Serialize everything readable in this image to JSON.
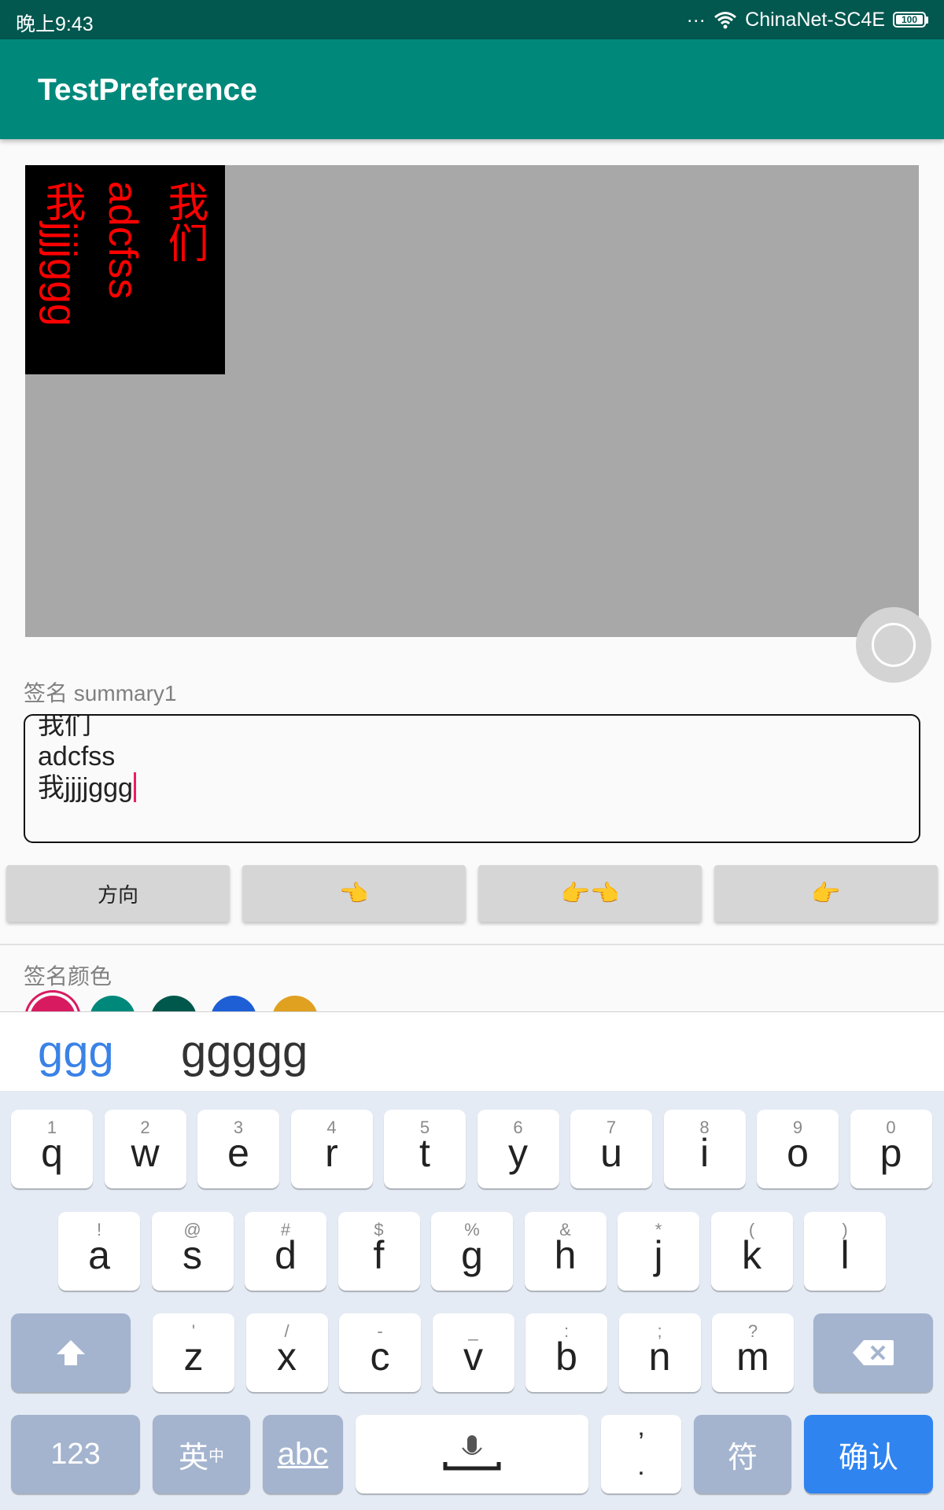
{
  "status_bar": {
    "time": "晚上9:43",
    "dots": "...",
    "network": "ChinaNet-SC4E",
    "battery": "100"
  },
  "app_bar": {
    "title": "TestPreference"
  },
  "preview": {
    "columns": [
      "我们",
      "adcfss",
      "我jjjjggg"
    ]
  },
  "signature": {
    "label": "签名",
    "summary": "summary1",
    "lines": [
      "我们",
      "adcfss",
      "我jjjjggg"
    ]
  },
  "buttons": [
    {
      "label": "方向"
    },
    {
      "label": "👈"
    },
    {
      "label": "👉👈"
    },
    {
      "label": "👉"
    }
  ],
  "color_section": {
    "label": "签名颜色",
    "swatches": [
      "#d81b60",
      "#00897b",
      "#00574b",
      "#1e5fd6",
      "#e0a020"
    ]
  },
  "keyboard": {
    "candidates": [
      "ggg",
      "ggggg"
    ],
    "row1": [
      {
        "k": "q",
        "s": "1"
      },
      {
        "k": "w",
        "s": "2"
      },
      {
        "k": "e",
        "s": "3"
      },
      {
        "k": "r",
        "s": "4"
      },
      {
        "k": "t",
        "s": "5"
      },
      {
        "k": "y",
        "s": "6"
      },
      {
        "k": "u",
        "s": "7"
      },
      {
        "k": "i",
        "s": "8"
      },
      {
        "k": "o",
        "s": "9"
      },
      {
        "k": "p",
        "s": "0"
      }
    ],
    "row2": [
      {
        "k": "a",
        "s": "!"
      },
      {
        "k": "s",
        "s": "@"
      },
      {
        "k": "d",
        "s": "#"
      },
      {
        "k": "f",
        "s": "$"
      },
      {
        "k": "g",
        "s": "%"
      },
      {
        "k": "h",
        "s": "&"
      },
      {
        "k": "j",
        "s": "*"
      },
      {
        "k": "k",
        "s": "("
      },
      {
        "k": "l",
        "s": ")"
      }
    ],
    "row3": [
      {
        "k": "z",
        "s": "'"
      },
      {
        "k": "x",
        "s": "/"
      },
      {
        "k": "c",
        "s": "-"
      },
      {
        "k": "v",
        "s": "_"
      },
      {
        "k": "b",
        "s": ":"
      },
      {
        "k": "n",
        "s": ";"
      },
      {
        "k": "m",
        "s": "?"
      }
    ],
    "num_label": "123",
    "lang_label": "英",
    "lang_sub": "中",
    "abc_label": "abc",
    "comma_top": "’",
    "comma_bottom": ".",
    "symbol_label": "符",
    "confirm_label": "确认"
  },
  "colors": {
    "status_bar": "#02574f",
    "app_bar": "#00897b",
    "accent": "#e91e63",
    "confirm": "#2f84f0"
  },
  "icons": [
    "wifi-icon",
    "battery-icon",
    "fab-circle-icon",
    "shift-arrow-icon",
    "backspace-icon",
    "microphone-icon"
  ]
}
